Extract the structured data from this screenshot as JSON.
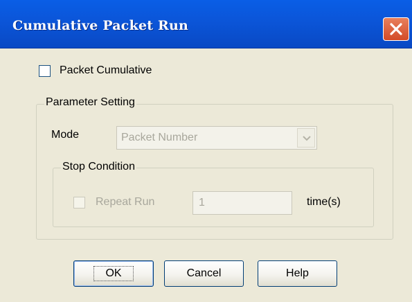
{
  "window": {
    "title": "Cumulative Packet Run"
  },
  "packet_cumulative": {
    "label": "Packet Cumulative",
    "checked": false
  },
  "parameter_setting": {
    "legend": "Parameter Setting",
    "mode_label": "Mode",
    "mode_value": "Packet Number",
    "stop_condition": {
      "legend": "Stop Condition",
      "repeat_run_label": "Repeat Run",
      "repeat_run_checked": false,
      "repeat_value": "1",
      "unit_label": "time(s)"
    }
  },
  "buttons": {
    "ok": "OK",
    "cancel": "Cancel",
    "help": "Help"
  },
  "icons": {
    "close": "close-icon",
    "dropdown": "chevron-down-icon"
  },
  "colors": {
    "titlebar": "#0b55d8",
    "close_button": "#d34a28",
    "dialog_background": "#ece9d8",
    "disabled_text": "#a8a79c"
  }
}
